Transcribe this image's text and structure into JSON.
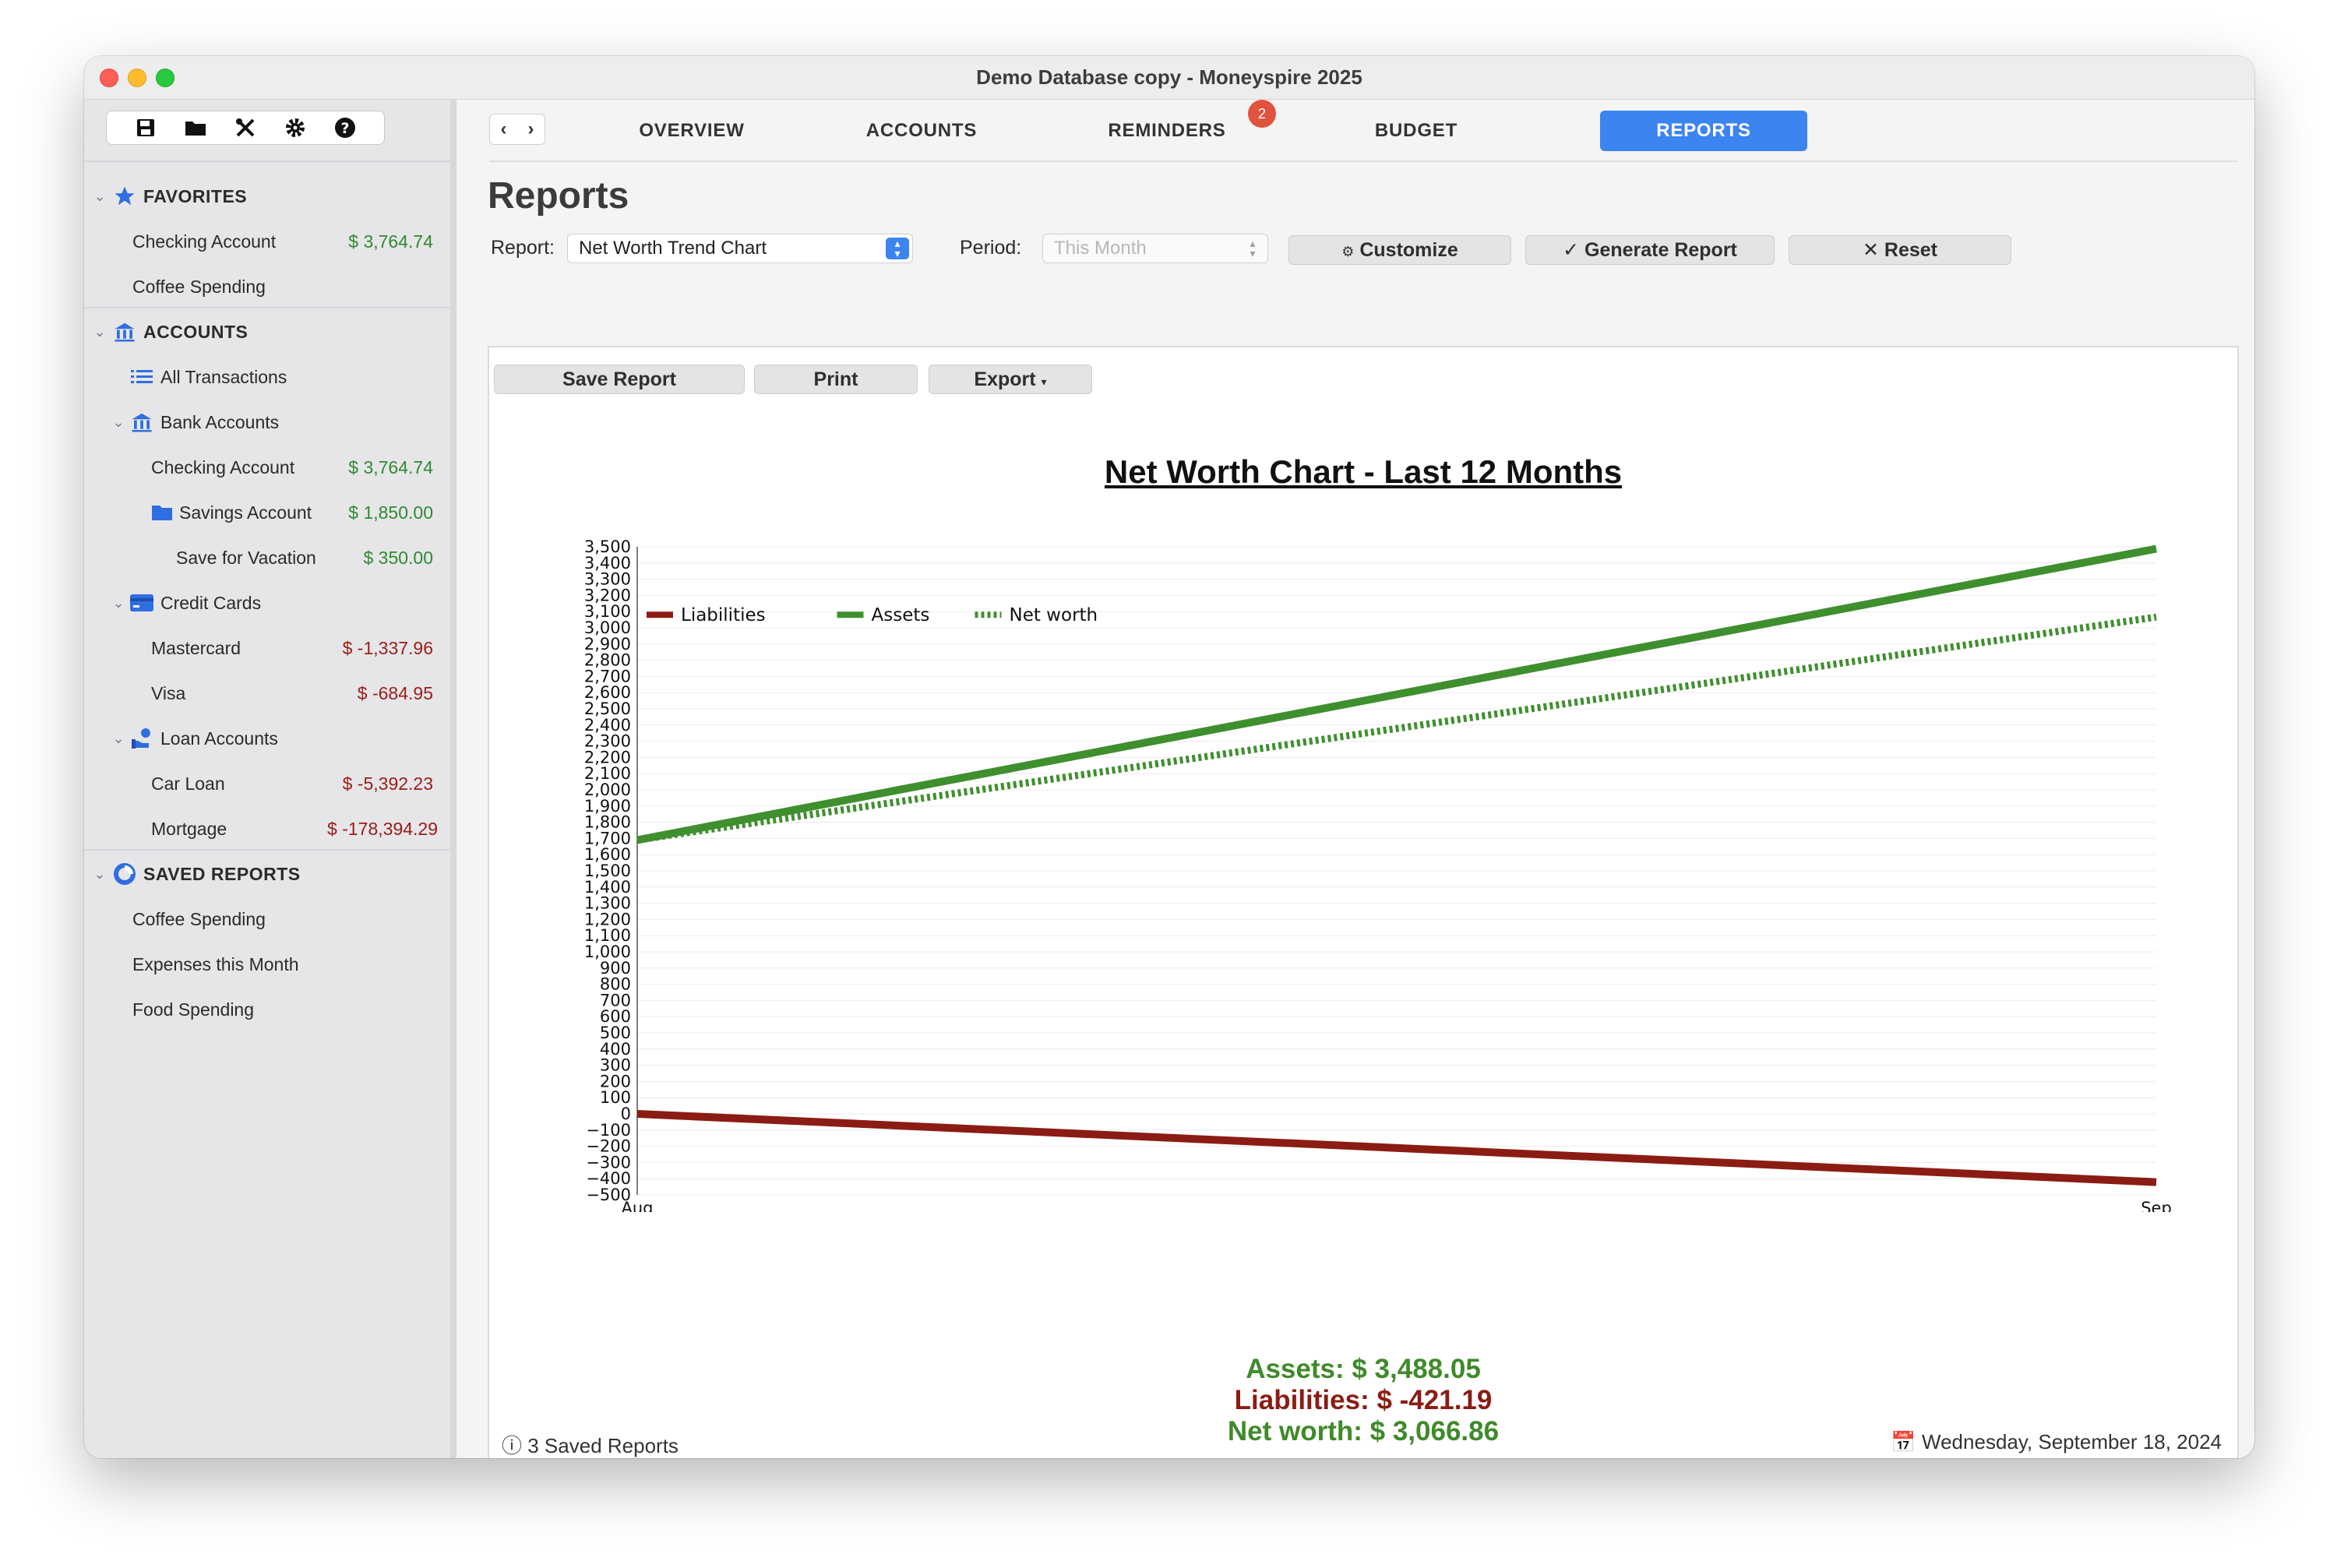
{
  "window": {
    "title": "Demo Database copy - Moneyspire 2025"
  },
  "sidebar": {
    "favorites": {
      "title": "FAVORITES",
      "items": [
        {
          "label": "Checking Account",
          "amount": "$ 3,764.74"
        },
        {
          "label": "Coffee Spending"
        }
      ]
    },
    "accounts": {
      "title": "ACCOUNTS",
      "all_transactions": "All Transactions",
      "bank": {
        "label": "Bank Accounts",
        "checking": {
          "label": "Checking Account",
          "amount": "$ 3,764.74"
        },
        "savings": {
          "label": "Savings Account",
          "amount": "$ 1,850.00"
        },
        "vacation": {
          "label": "Save for Vacation",
          "amount": "$ 350.00"
        }
      },
      "credit": {
        "label": "Credit Cards",
        "mastercard": {
          "label": "Mastercard",
          "amount": "$ -1,337.96"
        },
        "visa": {
          "label": "Visa",
          "amount": "$ -684.95"
        }
      },
      "loan": {
        "label": "Loan Accounts",
        "car": {
          "label": "Car Loan",
          "amount": "$ -5,392.23"
        },
        "mortgage": {
          "label": "Mortgage",
          "amount": "$ -178,394.29"
        }
      }
    },
    "saved_reports": {
      "title": "SAVED REPORTS",
      "items": [
        "Coffee Spending",
        "Expenses this Month",
        "Food Spending"
      ]
    }
  },
  "tabs": {
    "overview": "OVERVIEW",
    "accounts": "ACCOUNTS",
    "reminders": "REMINDERS",
    "reminders_badge": "2",
    "budget": "BUDGET",
    "reports": "REPORTS"
  },
  "page": {
    "title": "Reports",
    "report_label": "Report:",
    "report_value": "Net Worth Trend Chart",
    "period_label": "Period:",
    "period_value": "This Month",
    "customize": "Customize",
    "generate": "Generate Report",
    "reset": "Reset",
    "save_report": "Save Report",
    "print": "Print",
    "export": "Export"
  },
  "chart_data": {
    "type": "line",
    "title": "Net Worth Chart - Last 12 Months",
    "x": [
      "Aug",
      "Sep"
    ],
    "ylim": [
      -500,
      3500
    ],
    "ytick_step": 100,
    "grid": true,
    "legend_position": "top-left",
    "series": [
      {
        "name": "Liabilities",
        "values": [
          0,
          -421.19
        ],
        "color": "#8b1c14",
        "style": "solid"
      },
      {
        "name": "Assets",
        "values": [
          1690,
          3488.05
        ],
        "color": "#3f8f2f",
        "style": "solid"
      },
      {
        "name": "Net worth",
        "values": [
          1690,
          3066.86
        ],
        "color": "#3f8f2f",
        "style": "dotted"
      }
    ]
  },
  "summary": {
    "assets": "Assets: $ 3,488.05",
    "liabilities": "Liabilities: $ -421.19",
    "net_worth": "Net worth: $ 3,066.86",
    "assets_color": "#3f8a2a",
    "liabilities_color": "#8b1c14"
  },
  "status": {
    "left": "3 Saved Reports",
    "right": "Wednesday, September 18, 2024"
  }
}
